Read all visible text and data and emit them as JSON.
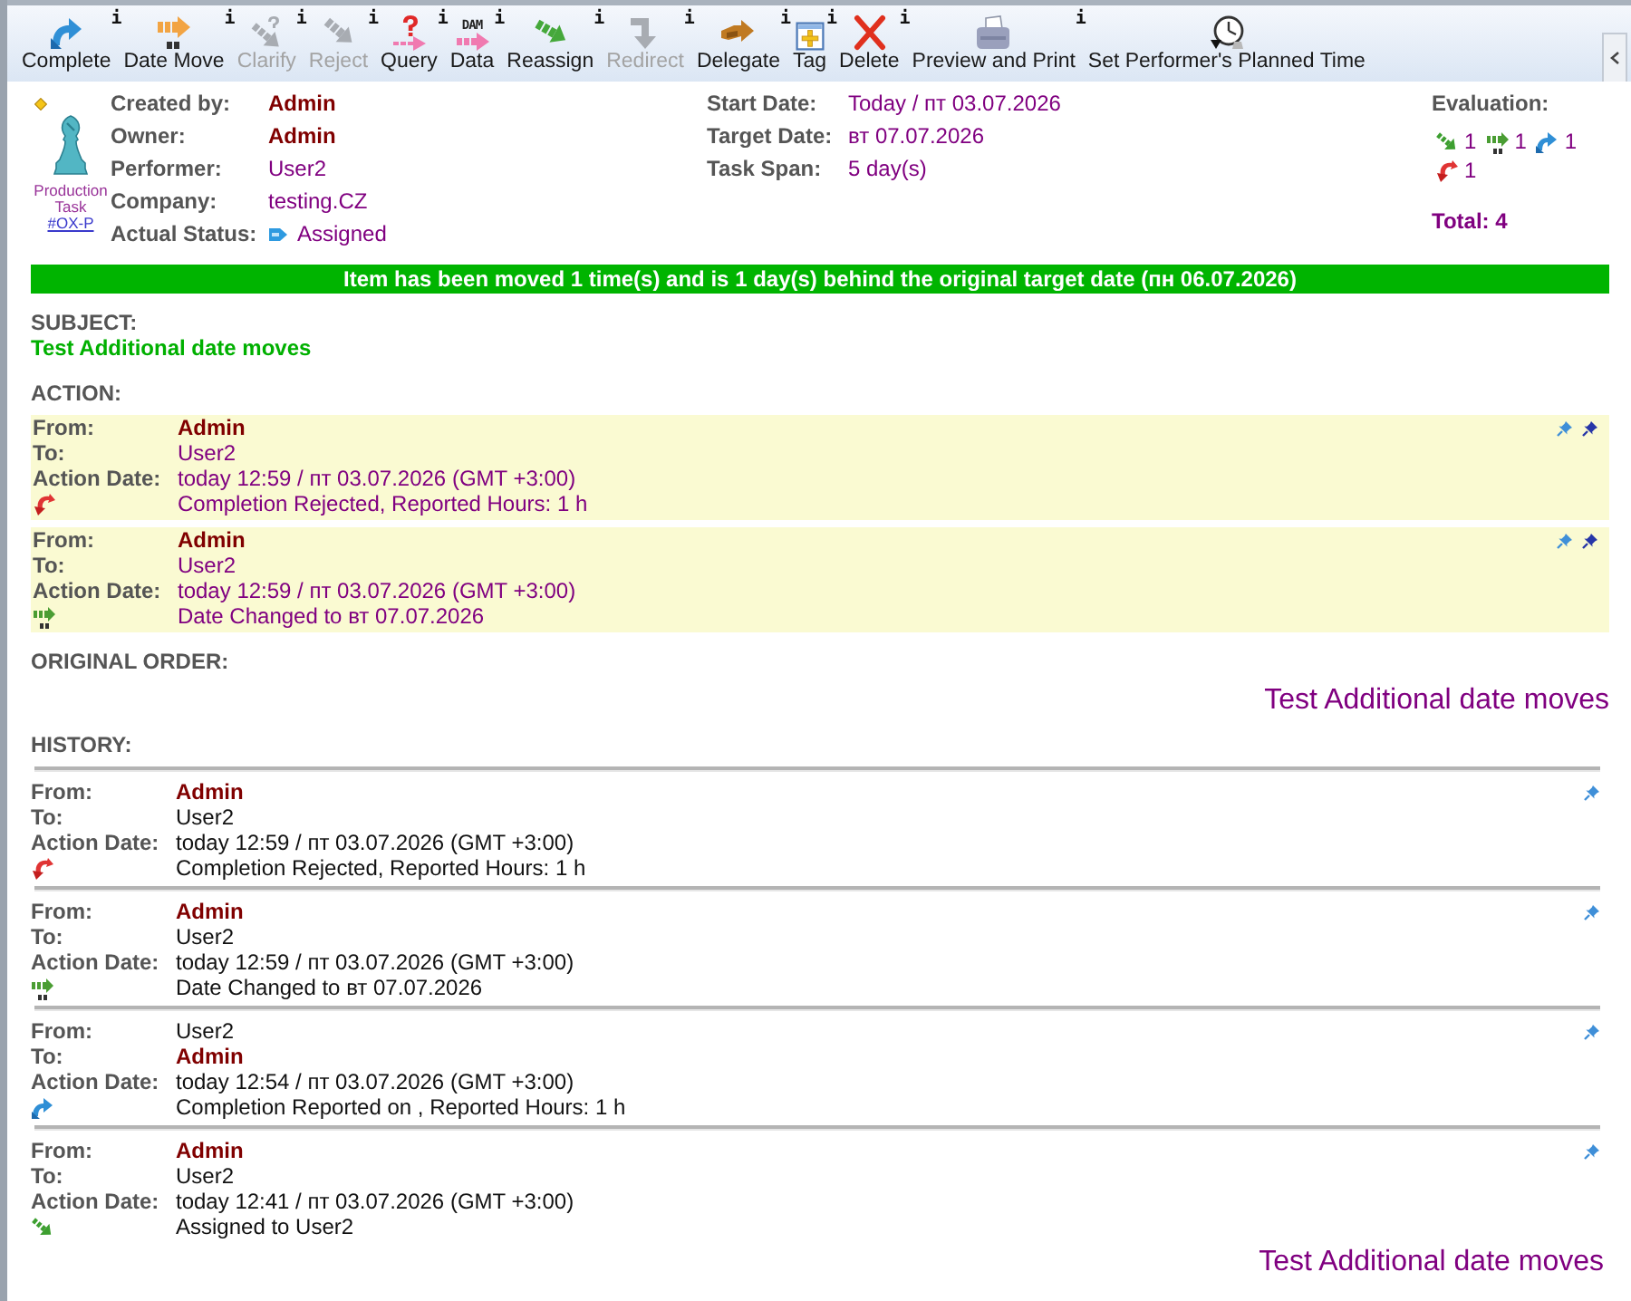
{
  "toolbar": {
    "buttons": [
      {
        "kind": "complete",
        "label": "Complete",
        "info": "i",
        "disabled": false
      },
      {
        "kind": "date_move",
        "label": "Date Move",
        "info": "i",
        "disabled": false
      },
      {
        "kind": "clarify",
        "label": "Clarify",
        "info": "i",
        "disabled": true
      },
      {
        "kind": "reject",
        "label": "Reject",
        "info": "i",
        "disabled": true
      },
      {
        "kind": "query",
        "label": "Query",
        "info": "i",
        "disabled": false
      },
      {
        "kind": "data",
        "label": "Data",
        "info": "i",
        "icon_text": "DAM",
        "disabled": false
      },
      {
        "kind": "reassign",
        "label": "Reassign",
        "info": "i",
        "disabled": false
      },
      {
        "kind": "redirect",
        "label": "Redirect",
        "info": "i",
        "disabled": true
      },
      {
        "kind": "delegate",
        "label": "Delegate",
        "info": "i",
        "disabled": false
      },
      {
        "kind": "tag",
        "label": "Tag",
        "info": "i",
        "disabled": false
      },
      {
        "kind": "delete",
        "label": "Delete",
        "info": "i",
        "disabled": false
      },
      {
        "kind": "print",
        "label": "Preview and Print",
        "info": "i",
        "disabled": false
      },
      {
        "kind": "planned_time",
        "label": "Set Performer's Planned Time",
        "disabled": false
      }
    ]
  },
  "task": {
    "type_label": "Production Task",
    "code": "#OX-P"
  },
  "details": [
    {
      "kind": "text",
      "label": "Created by:",
      "value": "Admin",
      "highlight": true
    },
    {
      "kind": "text",
      "label": "Owner:",
      "value": "Admin",
      "highlight": true
    },
    {
      "kind": "text",
      "label": "Performer:",
      "value": "User2",
      "highlight": false
    },
    {
      "kind": "text",
      "label": "Company:",
      "value": "testing.CZ",
      "highlight": false
    },
    {
      "kind": "status",
      "label": "Actual Status:",
      "value": "Assigned",
      "highlight": false
    }
  ],
  "dates": [
    {
      "label": "Start Date:",
      "value": "Today / пт 03.07.2026"
    },
    {
      "label": "Target Date:",
      "value": "вт 07.07.2026"
    },
    {
      "label": "Task Span:",
      "value": "5 day(s)"
    }
  ],
  "evaluation": {
    "title": "Evaluation:",
    "counts": [
      {
        "kind": "assign",
        "count": "1"
      },
      {
        "kind": "date_move",
        "count": "1"
      },
      {
        "kind": "complete",
        "count": "1"
      },
      {
        "kind": "reject",
        "count": "1"
      }
    ],
    "total": "Total: 4"
  },
  "banner": "Item has been moved 1 time(s) and is 1 day(s) behind the original target date (пн 06.07.2026)",
  "subject": {
    "title": "SUBJECT:",
    "text": "Test Additional date moves"
  },
  "action": {
    "title": "ACTION:",
    "entries": [
      {
        "kind": "reject",
        "fields": [
          {
            "label": "From:",
            "value": "Admin",
            "highlight": true
          },
          {
            "label": "To:",
            "value": "User2",
            "highlight": false
          },
          {
            "label": "Action Date:",
            "value": "today 12:59 / пт 03.07.2026 (GMT +3:00)"
          }
        ],
        "description": "Completion Rejected, Reported Hours: 1 h"
      },
      {
        "kind": "date_move",
        "fields": [
          {
            "label": "From:",
            "value": "Admin",
            "highlight": true
          },
          {
            "label": "To:",
            "value": "User2",
            "highlight": false
          },
          {
            "label": "Action Date:",
            "value": "today 12:59 / пт 03.07.2026 (GMT +3:00)"
          }
        ],
        "description": "Date Changed to вт 07.07.2026"
      }
    ]
  },
  "original_order": {
    "title": "ORIGINAL ORDER:",
    "text": "Test Additional date moves"
  },
  "history": {
    "title": "HISTORY:",
    "entries": [
      {
        "kind": "reject",
        "fields": [
          {
            "label": "From:",
            "value": "Admin",
            "highlight": true
          },
          {
            "label": "To:",
            "value": "User2",
            "highlight": false
          },
          {
            "label": "Action Date:",
            "value": "today 12:59 / пт 03.07.2026 (GMT +3:00)"
          }
        ],
        "description": "Completion Rejected, Reported Hours: 1 h"
      },
      {
        "kind": "date_move",
        "fields": [
          {
            "label": "From:",
            "value": "Admin",
            "highlight": true
          },
          {
            "label": "To:",
            "value": "User2",
            "highlight": false
          },
          {
            "label": "Action Date:",
            "value": "today 12:59 / пт 03.07.2026 (GMT +3:00)"
          }
        ],
        "description": "Date Changed to вт 07.07.2026"
      },
      {
        "kind": "complete",
        "fields": [
          {
            "label": "From:",
            "value": "User2",
            "highlight": false
          },
          {
            "label": "To:",
            "value": "Admin",
            "highlight": true
          },
          {
            "label": "Action Date:",
            "value": "today 12:54 / пт 03.07.2026 (GMT +3:00)"
          }
        ],
        "description": "Completion Reported on , Reported Hours: 1 h"
      },
      {
        "kind": "assign",
        "fields": [
          {
            "label": "From:",
            "value": "Admin",
            "highlight": true
          },
          {
            "label": "To:",
            "value": "User2",
            "highlight": false
          },
          {
            "label": "Action Date:",
            "value": "today 12:41 / пт 03.07.2026 (GMT +3:00)"
          }
        ],
        "description": "Assigned to User2"
      }
    ]
  },
  "footer_text": "Test Additional date moves"
}
